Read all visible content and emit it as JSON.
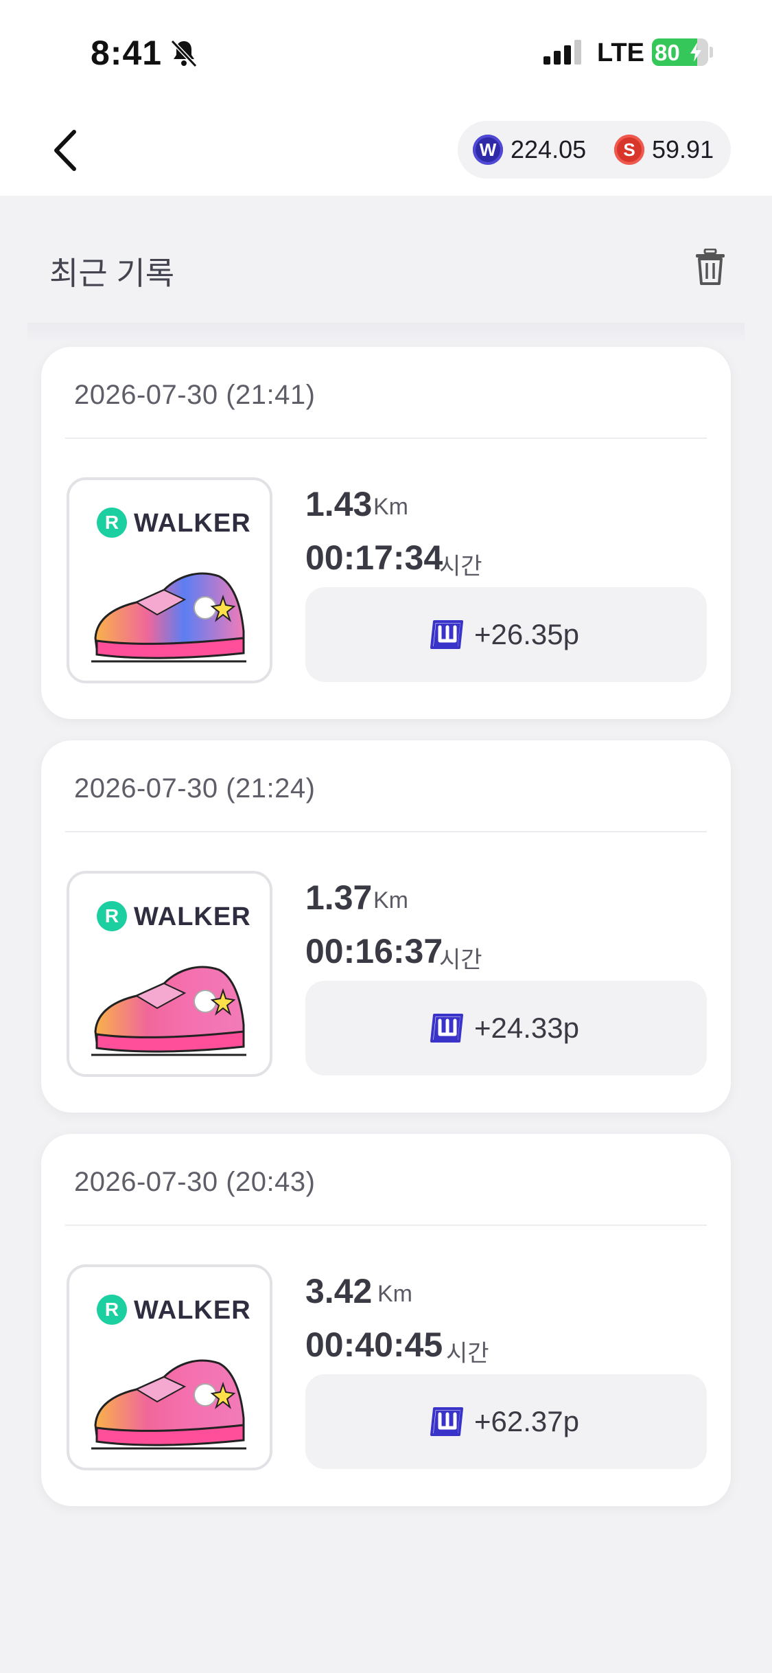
{
  "status_bar": {
    "time": "8:41",
    "network": "LTE",
    "battery": "80",
    "battery_level": 0.8
  },
  "header": {
    "back_icon": "chevron-left-icon",
    "balances": [
      {
        "icon": "w-coin-icon",
        "letter": "W",
        "value": "224.05",
        "color": "#2f2aa8"
      },
      {
        "icon": "s-coin-icon",
        "letter": "S",
        "value": "59.91",
        "color": "#d8352b"
      }
    ]
  },
  "section": {
    "title": "최근 기록",
    "delete_icon": "trash-icon"
  },
  "records": [
    {
      "date": "2026-07-30 (21:41)",
      "brand_letter": "R",
      "brand": "WALKER",
      "distance": "1.43",
      "distance_unit": "Km",
      "duration": "00:17:34",
      "duration_unit": "시간",
      "reward": "+26.35p"
    },
    {
      "date": "2026-07-30 (21:24)",
      "brand_letter": "R",
      "brand": "WALKER",
      "distance": "1.37",
      "distance_unit": "Km",
      "duration": "00:16:37",
      "duration_unit": "시간",
      "reward": "+24.33p"
    },
    {
      "date": "2026-07-30 (20:43)",
      "brand_letter": "R",
      "brand": "WALKER",
      "distance": "3.42",
      "distance_unit": "Km",
      "duration": "00:40:45",
      "duration_unit": "시간",
      "reward": "+62.37p"
    }
  ],
  "colors": {
    "accent_green": "#1ccfa0",
    "reward_icon": "#3a33c9",
    "background": "#f2f2f5"
  }
}
